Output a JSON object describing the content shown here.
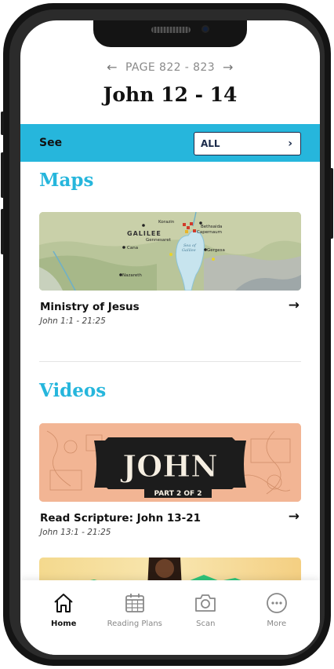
{
  "page_nav": {
    "prev_icon": "arrow-left-icon",
    "label": "PAGE 822 - 823",
    "next_icon": "arrow-right-icon"
  },
  "title": "John 12 - 14",
  "see_bar": {
    "label": "See",
    "select_value": "ALL",
    "color": "#26b6dc"
  },
  "maps": {
    "heading": "Maps",
    "item": {
      "title": "Ministry of Jesus",
      "reference": "John 1:1 - 21:25",
      "map_labels": {
        "region": "GALILEE",
        "sea": "Sea of Galilee",
        "towns": [
          "Korazin",
          "Bethsaida",
          "Capernaum",
          "Gennesaret",
          "Cana",
          "Gergesa",
          "Nazareth"
        ]
      }
    }
  },
  "videos": {
    "heading": "Videos",
    "item": {
      "title": "Read Scripture: John 13-21",
      "reference": "John 13:1 - 21:25",
      "banner_title": "JOHN",
      "banner_sub": "PART 2 OF 2"
    }
  },
  "tabs": [
    {
      "label": "Home",
      "icon": "home-icon",
      "active": true
    },
    {
      "label": "Reading Plans",
      "icon": "calendar-icon",
      "active": false
    },
    {
      "label": "Scan",
      "icon": "camera-icon",
      "active": false
    },
    {
      "label": "More",
      "icon": "more-icon",
      "active": false
    }
  ]
}
